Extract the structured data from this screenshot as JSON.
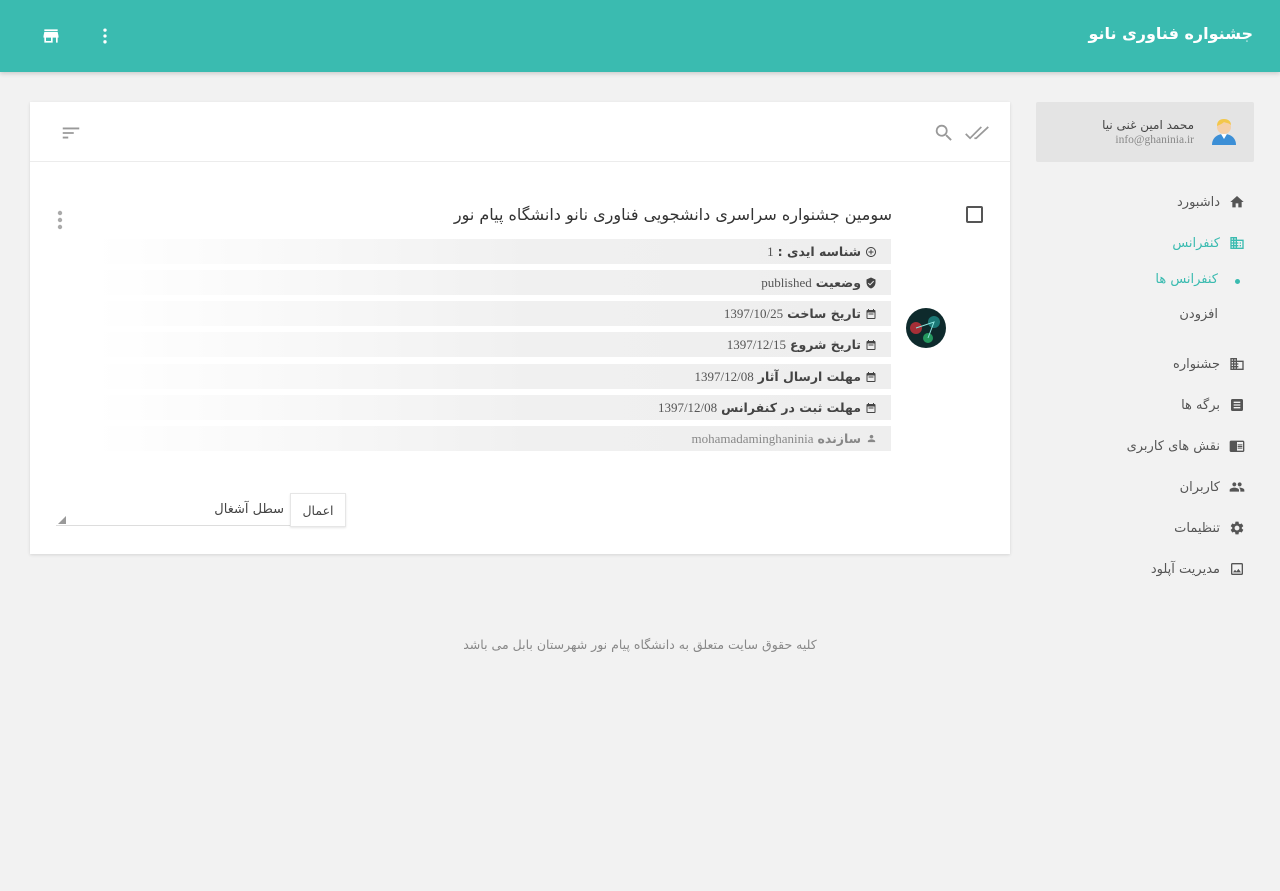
{
  "app": {
    "title": "جشنواره فناوری نانو"
  },
  "header": {
    "store_icon": "storefront-icon",
    "menu_icon": "more-vert-icon"
  },
  "profile": {
    "name": "محمد امین غنی نیا",
    "email": "info@ghaninia.ir"
  },
  "sidebar": {
    "items": [
      {
        "label": "داشبورد",
        "icon": "home-icon",
        "active": false
      },
      {
        "label": "کنفرانس",
        "icon": "building-icon",
        "active": true,
        "children": [
          {
            "label": "کنفرانس ها",
            "active": true
          },
          {
            "label": "افزودن",
            "active": false
          }
        ]
      },
      {
        "label": "جشنواره",
        "icon": "building-icon",
        "active": false
      },
      {
        "label": "برگه ها",
        "icon": "document-icon",
        "active": false
      },
      {
        "label": "نقش های کاربری",
        "icon": "chrome-reader-icon",
        "active": false
      },
      {
        "label": "کاربران",
        "icon": "people-icon",
        "active": false
      },
      {
        "label": "تنظیمات",
        "icon": "gear-icon",
        "active": false
      },
      {
        "label": "مدیریت آپلود",
        "icon": "image-icon",
        "active": false
      }
    ]
  },
  "record": {
    "title": "سومین جشنواره سراسری دانشجویی فناوری نانو دانشگاه پیام نور",
    "fields": [
      {
        "label": "شناسه ایدی :",
        "value": "1",
        "icon": "add-circle-icon"
      },
      {
        "label": "وضعیت",
        "value": "published",
        "icon": "shield-check-icon"
      },
      {
        "label": "تاریخ ساخت",
        "value": "1397/10/25",
        "icon": "calendar-icon"
      },
      {
        "label": "تاریخ شروع",
        "value": "1397/12/15",
        "icon": "calendar-icon"
      },
      {
        "label": "مهلت ارسال آثار",
        "value": "1397/12/08",
        "icon": "calendar-icon"
      },
      {
        "label": "مهلت ثبت در کنفرانس",
        "value": "1397/12/08",
        "icon": "calendar-icon"
      },
      {
        "label": "سازنده",
        "value": "mohamadaminghaninia",
        "icon": "person-icon"
      }
    ]
  },
  "bulk": {
    "select_label": "سطل آشغال",
    "apply_label": "اعمال"
  },
  "footer": {
    "text": "کلیه حقوق سایت متعلق به دانشگاه پیام نور شهرستان بابل می باشد"
  },
  "colors": {
    "accent": "#3abbb0",
    "background": "#f2f2f2",
    "card": "#ffffff"
  }
}
